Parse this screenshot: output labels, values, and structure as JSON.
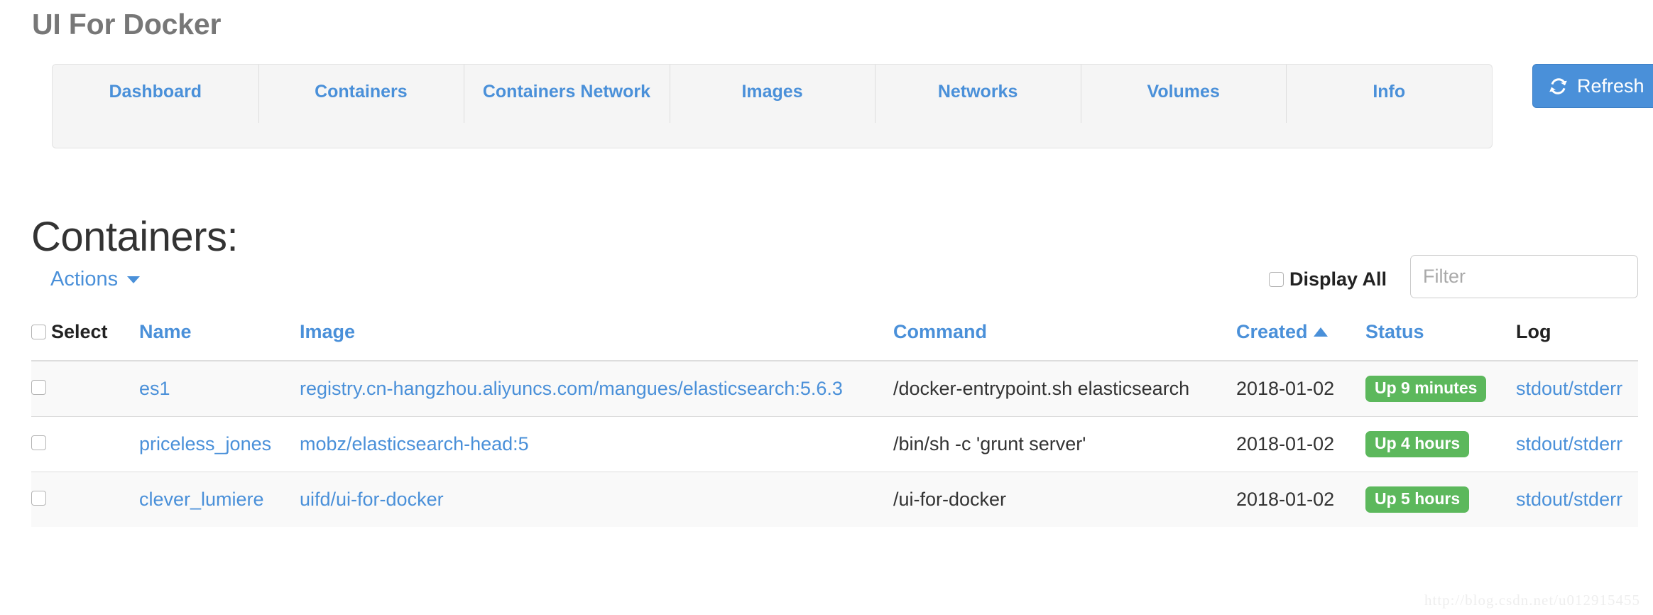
{
  "app": {
    "title": "UI For Docker"
  },
  "nav": {
    "tabs": [
      {
        "label": "Dashboard"
      },
      {
        "label": "Containers"
      },
      {
        "label": "Containers Network"
      },
      {
        "label": "Images"
      },
      {
        "label": "Networks"
      },
      {
        "label": "Volumes"
      },
      {
        "label": "Info"
      }
    ]
  },
  "toolbar": {
    "refresh_label": "Refresh",
    "refresh_icon": "refresh-icon",
    "refresh_color": "#4a90d9"
  },
  "page": {
    "heading": "Containers:"
  },
  "controls": {
    "actions_label": "Actions",
    "actions_caret_icon": "caret-down-icon",
    "display_all_label": "Display All",
    "display_all_checked": false,
    "filter_placeholder": "Filter",
    "filter_value": ""
  },
  "table": {
    "columns": [
      {
        "key": "select",
        "label": "Select",
        "sortable": false,
        "link": false
      },
      {
        "key": "name",
        "label": "Name",
        "sortable": true,
        "link": true
      },
      {
        "key": "image",
        "label": "Image",
        "sortable": true,
        "link": true
      },
      {
        "key": "command",
        "label": "Command",
        "sortable": true,
        "link": true
      },
      {
        "key": "created",
        "label": "Created",
        "sortable": true,
        "link": true,
        "sort_direction": "asc",
        "sort_icon": "caret-up-icon"
      },
      {
        "key": "status",
        "label": "Status",
        "sortable": true,
        "link": true
      },
      {
        "key": "log",
        "label": "Log",
        "sortable": false,
        "link": false
      }
    ],
    "rows": [
      {
        "selected": false,
        "name": "es1",
        "image": "registry.cn-hangzhou.aliyuncs.com/mangues/elasticsearch:5.6.3",
        "command": "/docker-entrypoint.sh elasticsearch",
        "created": "2018-01-02",
        "status": "Up 9 minutes",
        "status_color": "#5cb85c",
        "log": "stdout/stderr"
      },
      {
        "selected": false,
        "name": "priceless_jones",
        "image": "mobz/elasticsearch-head:5",
        "command": "/bin/sh -c 'grunt server'",
        "created": "2018-01-02",
        "status": "Up 4 hours",
        "status_color": "#5cb85c",
        "log": "stdout/stderr"
      },
      {
        "selected": false,
        "name": "clever_lumiere",
        "image": "uifd/ui-for-docker",
        "command": "/ui-for-docker",
        "created": "2018-01-02",
        "status": "Up 5 hours",
        "status_color": "#5cb85c",
        "log": "stdout/stderr"
      }
    ]
  },
  "watermark": {
    "text": "http://blog.csdn.net/u012915455"
  }
}
